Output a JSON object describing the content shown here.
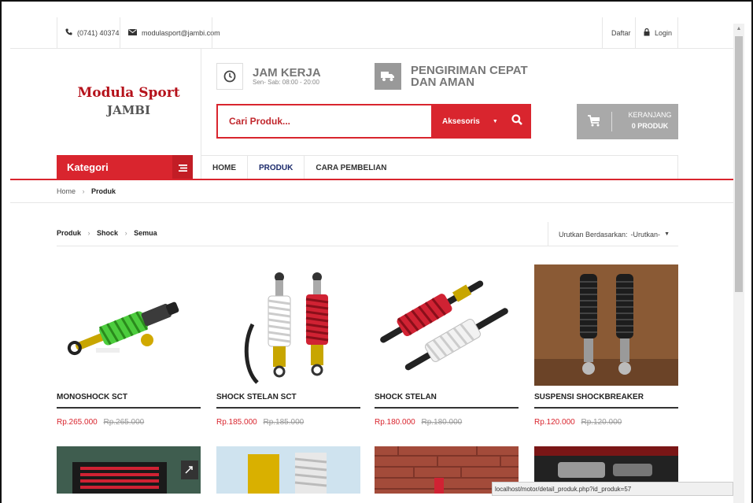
{
  "topbar": {
    "phone": "(0741) 40374",
    "email": "modulasport@jambi.com",
    "register": "Daftar",
    "login": "Login"
  },
  "logo": {
    "title": "Modula Sport",
    "subtitle": "JAMBI"
  },
  "features": [
    {
      "title": "JAM KERJA",
      "sub": "Sen- Sab: 08:00 - 20:00",
      "icon": "clock-icon"
    },
    {
      "title_line1": "PENGIRIMAN CEPAT",
      "title_line2": "DAN AMAN",
      "icon": "truck-icon"
    }
  ],
  "search": {
    "placeholder": "Cari Produk...",
    "category": "Aksesoris"
  },
  "cart": {
    "label": "KERANJANG",
    "count": "0 PRODUK"
  },
  "nav": {
    "kategori": "Kategori",
    "items": [
      {
        "label": "HOME"
      },
      {
        "label": "PRODUK"
      },
      {
        "label": "CARA PEMBELIAN"
      }
    ]
  },
  "breadcrumb": {
    "home": "Home",
    "current": "Produk"
  },
  "subhead": {
    "path": [
      "Produk",
      "Shock",
      "Semua"
    ],
    "sort_label": "Urutkan Berdasarkan:",
    "sort_value": "-Urutkan-"
  },
  "products": [
    {
      "name": "MONOSHOCK SCT",
      "price": "Rp.265.000",
      "old_price": "Rp.265.000"
    },
    {
      "name": "SHOCK STELAN SCT",
      "price": "Rp.185.000",
      "old_price": "Rp.185.000"
    },
    {
      "name": "SHOCK STELAN",
      "price": "Rp.180.000",
      "old_price": "Rp.180.000"
    },
    {
      "name": "SUSPENSI SHOCKBREAKER",
      "price": "Rp.120.000",
      "old_price": "Rp.120.000"
    }
  ],
  "status_url": "localhost/motor/detail_produk.php?id_produk=57",
  "colors": {
    "accent": "#d9252e",
    "nav_active": "#1b2a6b",
    "cart_bg": "#a9a9a9"
  }
}
